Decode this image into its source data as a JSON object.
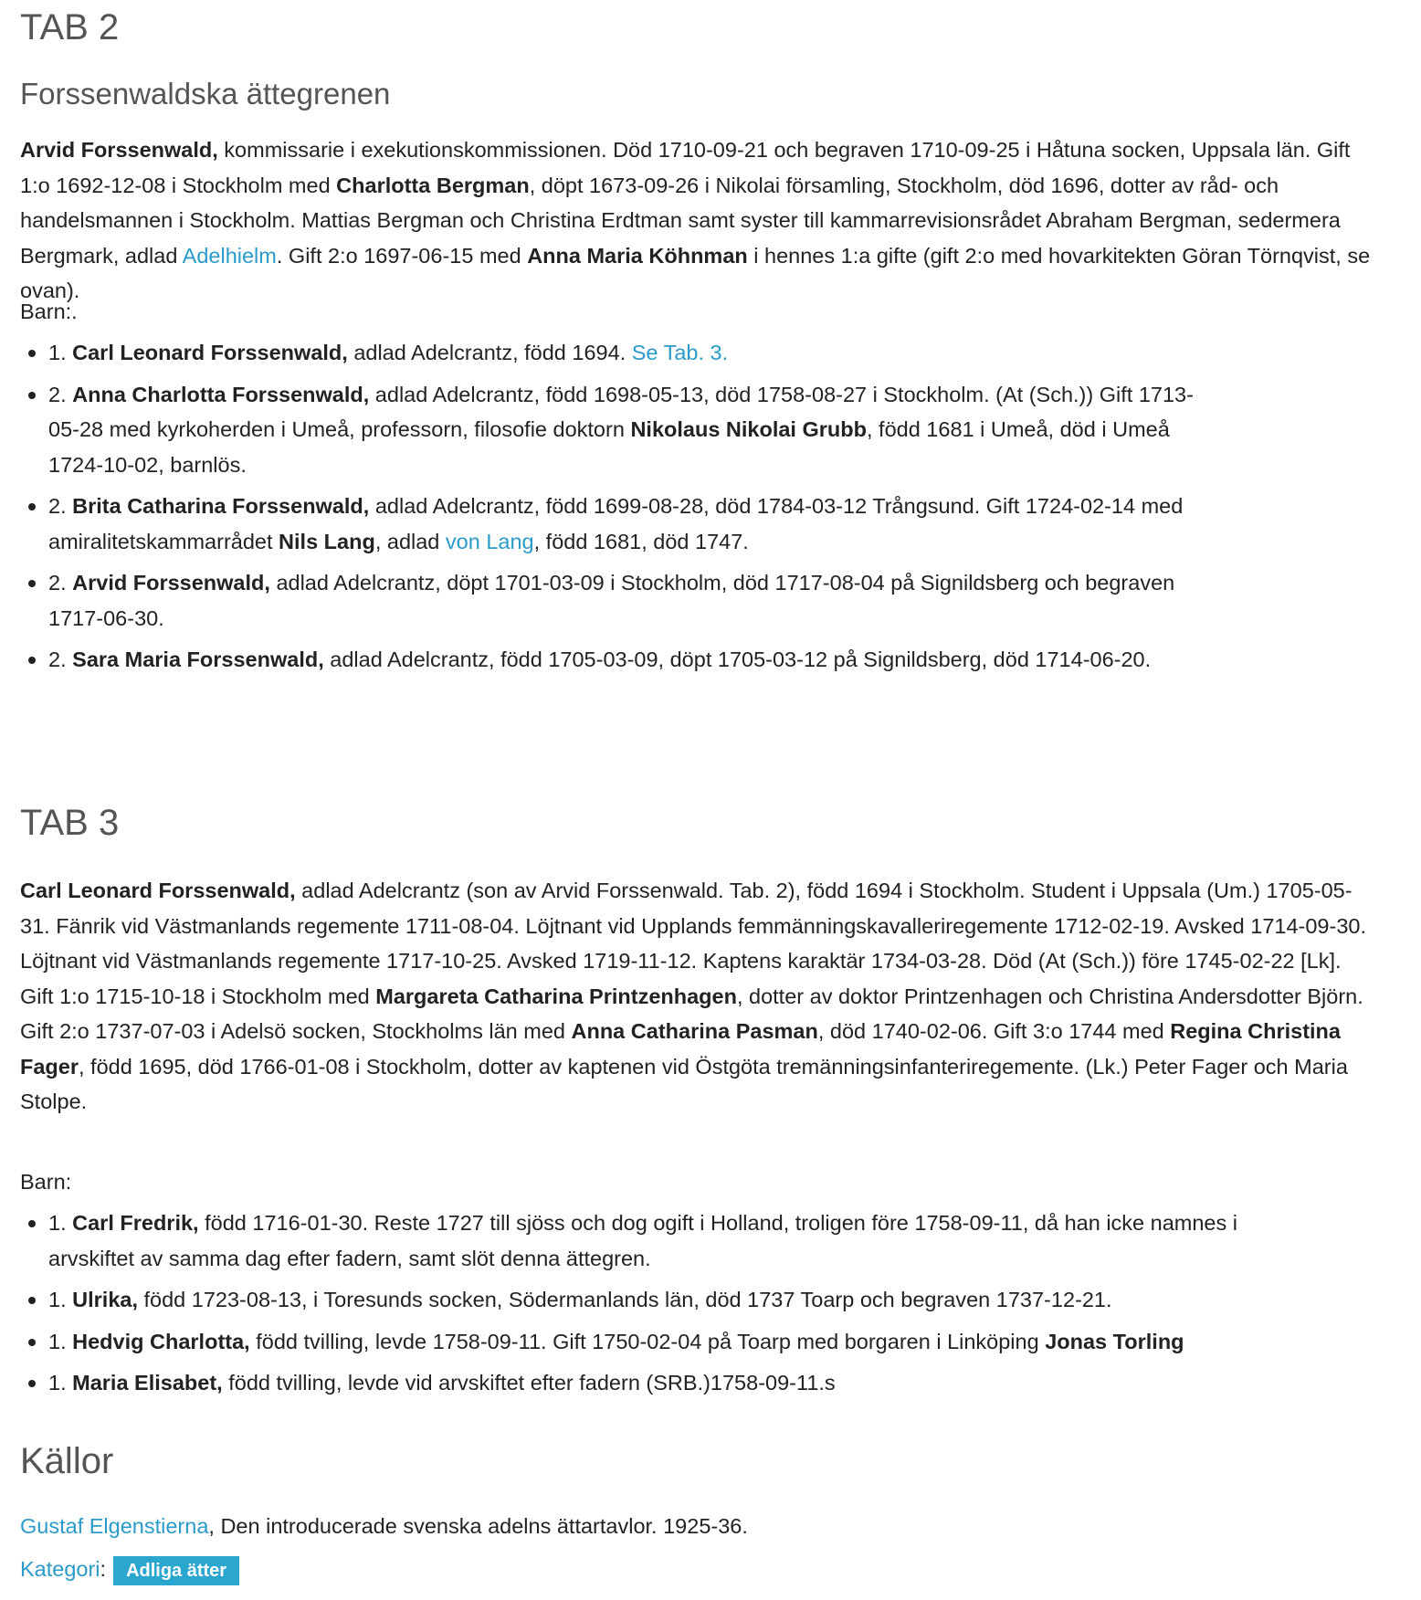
{
  "tab2": {
    "heading": "TAB 2",
    "subheading": "Forssenwaldska ättegrenen",
    "intro": {
      "name": "Arvid Forssenwald,",
      "t1": " kommissarie i exekutionskommissionen. Död 1710-09-21 och begraven 1710-09-25 i Håtuna socken, Uppsala län. Gift 1:o 1692-12-08 i Stockholm med ",
      "spouse1": "Charlotta Bergman",
      "t2": ", döpt 1673-09-26 i Nikolai församling, Stockholm, död 1696, dotter av råd- och handelsmannen i Stockholm. Mattias Bergman och Christina Erdtman samt syster till kammarrevisionsrådet Abraham Bergman, sedermera Bergmark, adlad ",
      "link": "Adelhielm",
      "t3": ". Gift 2:o 1697-06-15 med ",
      "spouse2": "Anna Maria Köhnman",
      "t4": " i hennes 1:a gifte (gift 2:o med hovarkitekten Göran Törnqvist, se ovan)."
    },
    "children_label": "Barn:.",
    "children": [
      {
        "num": "1. ",
        "name": "Carl Leonard Forssenwald,",
        "t1": " adlad Adelcrantz, född 1694. ",
        "link": "Se Tab. 3."
      },
      {
        "num": "2. ",
        "name": "Anna Charlotta Forssenwald,",
        "t1": " adlad Adelcrantz, född 1698-05-13, död 1758-08-27 i Stockholm. (At (Sch.)) Gift 1713-05-28 med kyrkoherden i Umeå, professorn, filosofie doktorn ",
        "bold2": "Nikolaus Nikolai Grubb",
        "t2": ", född 1681 i Umeå, död i Umeå 1724-10-02, barnlös."
      },
      {
        "num": "2. ",
        "name": "Brita Catharina Forssenwald,",
        "t1": " adlad Adelcrantz, född 1699-08-28, död 1784-03-12 Trångsund. Gift 1724-02-14 med amiralitetskammarrådet ",
        "bold2": "Nils Lang",
        "t2": ", adlad ",
        "link": "von Lang",
        "t3": ", född 1681, död 1747."
      },
      {
        "num": "2. ",
        "name": "Arvid Forssenwald,",
        "t1": " adlad Adelcrantz, döpt 1701-03-09 i Stockholm, död 1717-08-04 på Signildsberg och begraven 1717-06-30."
      },
      {
        "num": "2. ",
        "name": "Sara Maria Forssenwald,",
        "t1": " adlad Adelcrantz, född 1705-03-09, döpt 1705-03-12 på Signildsberg, död 1714-06-20."
      }
    ]
  },
  "tab3": {
    "heading": "TAB 3",
    "intro": {
      "name": "Carl Leonard Forssenwald,",
      "t1": " adlad Adelcrantz (son av Arvid Forssenwald. Tab. 2), född 1694 i Stockholm. Student i Uppsala (Um.) 1705-05-31. Fänrik vid Västmanlands regemente 1711-08-04. Löjtnant vid Upplands femmänningskavalleriregemente 1712-02-19. Avsked 1714-09-30. Löjtnant vid Västmanlands regemente 1717-10-25. Avsked 1719-11-12. Kaptens karaktär 1734-03-28. Död (At (Sch.)) före 1745-02-22 [Lk]. Gift 1:o 1715-10-18 i Stockholm med ",
      "spouse1": "Margareta Catharina Printzenhagen",
      "t2": ", dotter av doktor Printzenhagen och Christina Andersdotter Björn. Gift 2:o 1737-07-03 i Adelsö socken, Stockholms län med ",
      "spouse2": "Anna Catharina Pasman",
      "t3": ", död 1740-02-06. Gift 3:o 1744 med ",
      "spouse3": "Regina Christina Fager",
      "t4": ", född 1695, död 1766-01-08 i Stockholm, dotter av kaptenen vid Östgöta tremänningsinfanteriregemente. (Lk.) Peter Fager och Maria Stolpe."
    },
    "children_label": "Barn:",
    "children": [
      {
        "num": "1. ",
        "name": "Carl Fredrik,",
        "t1": " född 1716-01-30. Reste 1727 till sjöss och dog ogift i Holland, troligen före 1758-09-11, då han icke namnes i arvskiftet av samma dag efter fadern, samt slöt denna ättegren."
      },
      {
        "num": "1. ",
        "name": "Ulrika,",
        "t1": " född 1723-08-13, i Toresunds socken, Södermanlands län, död 1737 Toarp och begraven 1737-12-21."
      },
      {
        "num": "1. ",
        "name": "Hedvig Charlotta,",
        "t1": " född tvilling, levde 1758-09-11. Gift 1750-02-04 på Toarp med borgaren i Linköping ",
        "bold2": "Jonas Torling"
      },
      {
        "num": "1. ",
        "name": "Maria Elisabet,",
        "t1": " född tvilling, levde vid arvskiftet efter fadern (SRB.)1758-09-11.s"
      }
    ]
  },
  "sources": {
    "heading": "Källor",
    "author_link": "Gustaf Elgenstierna",
    "citation": ", Den introducerade svenska adelns ättartavlor. 1925-36."
  },
  "category": {
    "label_link": "Kategori",
    "colon": ":",
    "badge": "Adliga ätter"
  },
  "colors": {
    "link": "#2a9bc8",
    "badge_bg": "#2aa6cf",
    "heading": "#555555",
    "text": "#222222"
  }
}
